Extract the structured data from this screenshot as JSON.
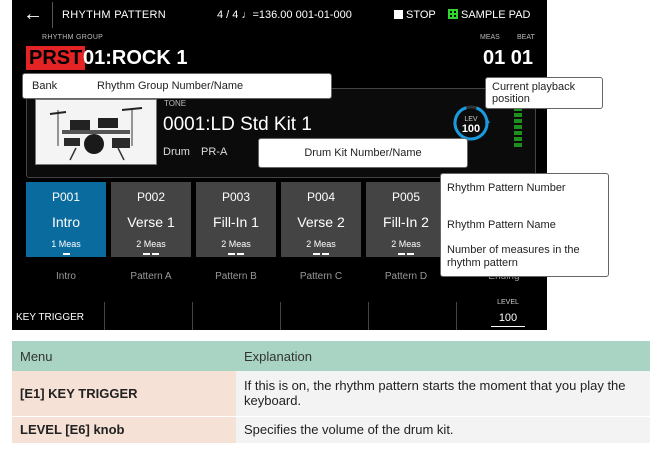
{
  "topbar": {
    "back_icon": "left-arrow-icon",
    "title": "RHYTHM PATTERN",
    "tempo": "4 / 4 ♩=136.00  001-01-000",
    "stop_label": "STOP",
    "sample_pad_label": "SAMPLE PAD"
  },
  "rhythm_group": {
    "label": "RHYTHM GROUP",
    "bank": "PRST",
    "name": "01:ROCK 1",
    "meas_label": "MEAS",
    "beat_label": "BEAT",
    "position": "01 01"
  },
  "drum_kit": {
    "tone_label": "TONE",
    "name": "0001:LD Std Kit 1",
    "category": "Drum",
    "bank": "PR-A",
    "level_label": "LEV",
    "level_value": "100",
    "level_fraction": 1.0
  },
  "pads": [
    {
      "num": "P001",
      "name": "Intro",
      "meas": "1",
      "variation": "Intro",
      "bars": 1,
      "selected": true
    },
    {
      "num": "P002",
      "name": "Verse 1",
      "meas": "2",
      "variation": "Pattern A",
      "bars": 2,
      "selected": false
    },
    {
      "num": "P003",
      "name": "Fill-In 1",
      "meas": "2",
      "variation": "Pattern B",
      "bars": 2,
      "selected": false
    },
    {
      "num": "P004",
      "name": "Verse 2",
      "meas": "2",
      "variation": "Pattern C",
      "bars": 2,
      "selected": false
    },
    {
      "num": "P005",
      "name": "Fill-In 2",
      "meas": "2",
      "variation": "Pattern D",
      "bars": 2,
      "selected": false
    }
  ],
  "pad_meas_unit": "Meas",
  "pad6_variation": "Ending",
  "funcbar": {
    "e1_label": "KEY TRIGGER",
    "level_label": "LEVEL",
    "level_value": "100"
  },
  "callouts": {
    "bank": "Bank",
    "rg_number_name": "Rhythm Group Number/Name",
    "playback_position": "Current playback position",
    "drum_kit": "Drum Kit Number/Name",
    "pattern_number": "Rhythm Pattern Number",
    "pattern_name": "Rhythm Pattern Name",
    "measures": "Number of measures in the rhythm pattern"
  },
  "menu_table": {
    "header_menu": "Menu",
    "header_explanation": "Explanation",
    "rows": [
      {
        "menu": "[E1] KEY TRIGGER",
        "explanation": "If this is on, the rhythm pattern starts the moment that you play the keyboard."
      },
      {
        "menu": "LEVEL [E6] knob",
        "explanation": "Specifies the volume of the drum kit."
      }
    ]
  },
  "colors": {
    "accent_blue": "#0a6b9f",
    "prst_red": "#e42424",
    "level_ring": "#1a9be0",
    "meter_green": "#1e8f1e",
    "table_header": "#a9d4c4",
    "table_menu_cell": "#f5e1d5"
  }
}
